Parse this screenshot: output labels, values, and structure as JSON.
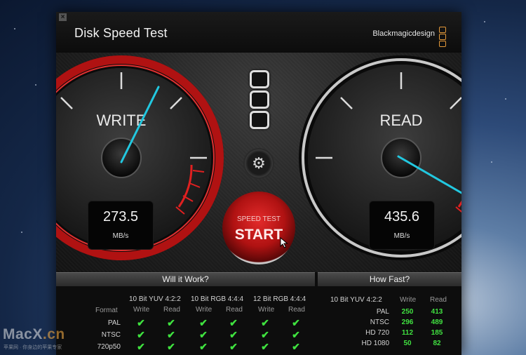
{
  "window": {
    "title": "Disk Speed Test",
    "close_label": "×",
    "brand": "Blackmagicdesign"
  },
  "gauges": {
    "write": {
      "label": "WRITE",
      "value": "273.5",
      "unit": "MB/s"
    },
    "read": {
      "label": "READ",
      "value": "435.6",
      "unit": "MB/s"
    }
  },
  "controls": {
    "settings_icon": "gear-icon",
    "start_sub": "SPEED TEST",
    "start_main": "START"
  },
  "will_it_work": {
    "header": "Will it Work?",
    "groups": [
      "10 Bit YUV 4:2:2",
      "10 Bit RGB 4:4:4",
      "12 Bit RGB 4:4:4"
    ],
    "col_format": "Format",
    "col_write": "Write",
    "col_read": "Read",
    "rows": [
      "PAL",
      "NTSC",
      "720p50"
    ],
    "check_glyph": "✔"
  },
  "how_fast": {
    "header": "How Fast?",
    "group": "10 Bit YUV 4:2:2",
    "col_write": "Write",
    "col_read": "Read",
    "rows": [
      {
        "format": "PAL",
        "write": "250",
        "read": "413"
      },
      {
        "format": "NTSC",
        "write": "296",
        "read": "489"
      },
      {
        "format": "HD 720",
        "write": "112",
        "read": "185"
      },
      {
        "format": "HD 1080",
        "write": "50",
        "read": "82"
      }
    ]
  },
  "watermark": {
    "text": "MacX",
    "suffix": ".cn",
    "sub": "苹果网 · 你身边的苹果专家"
  },
  "colors": {
    "accent_red": "#b01212",
    "needle": "#22c8e0",
    "ok_green": "#40e040",
    "logo_orange": "#e59a3a"
  }
}
